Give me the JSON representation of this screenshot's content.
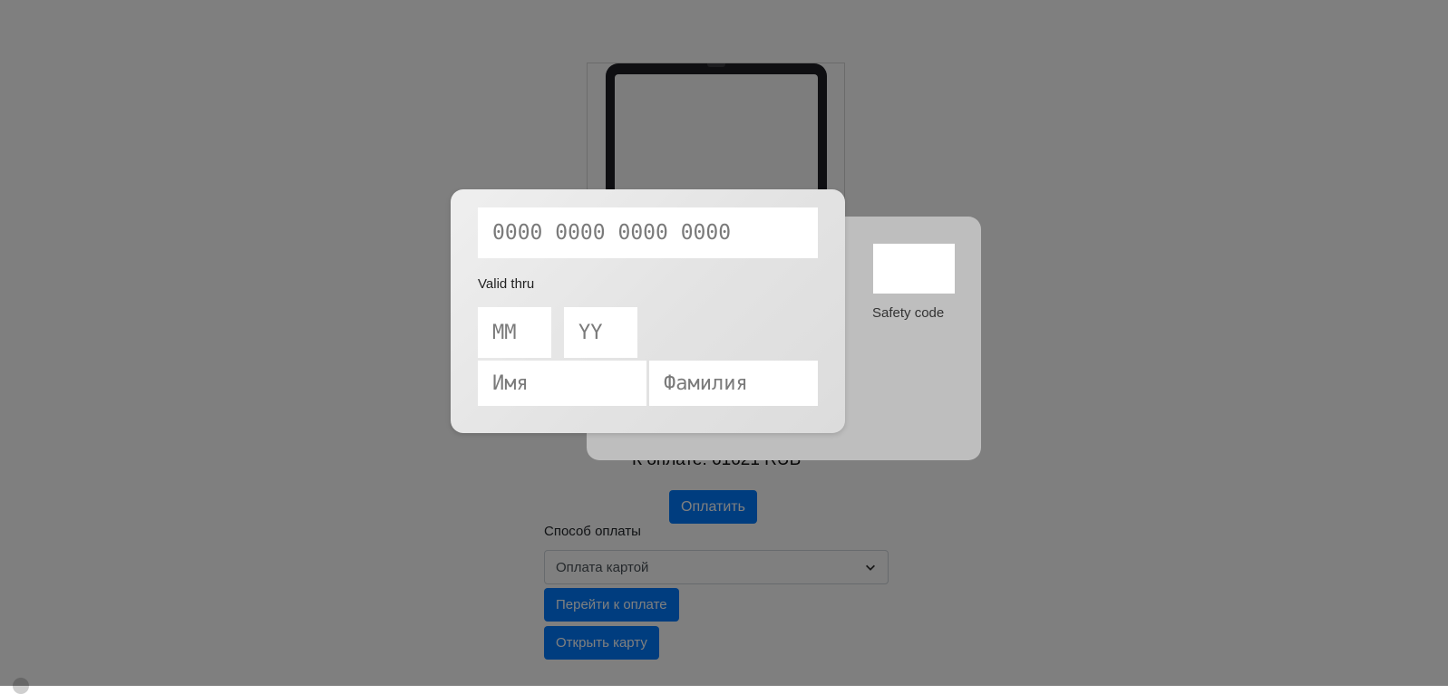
{
  "product": {
    "image_icon": "tablet-icon"
  },
  "summary": {
    "amount_text": "К оплате: 61621 RUB",
    "pay_button": "Оплатить"
  },
  "payment": {
    "method_label": "Способ оплаты",
    "method_selected": "Оплата картой",
    "goto_button": "Перейти к оплате",
    "open_card_button": "Открыть карту"
  },
  "card_front": {
    "number_placeholder": "0000 0000 0000 0000",
    "valid_thru_label": "Valid thru",
    "month_placeholder": "MM",
    "year_placeholder": "YY",
    "first_name_placeholder": "Имя",
    "last_name_placeholder": "Фамилия"
  },
  "card_back": {
    "safety_code_label": "Safety code"
  },
  "colors": {
    "primary": "#007bff",
    "overlay": "rgba(0,0,0,0.5)",
    "card_front": "#e6e6e6",
    "card_back": "#bebebe"
  }
}
